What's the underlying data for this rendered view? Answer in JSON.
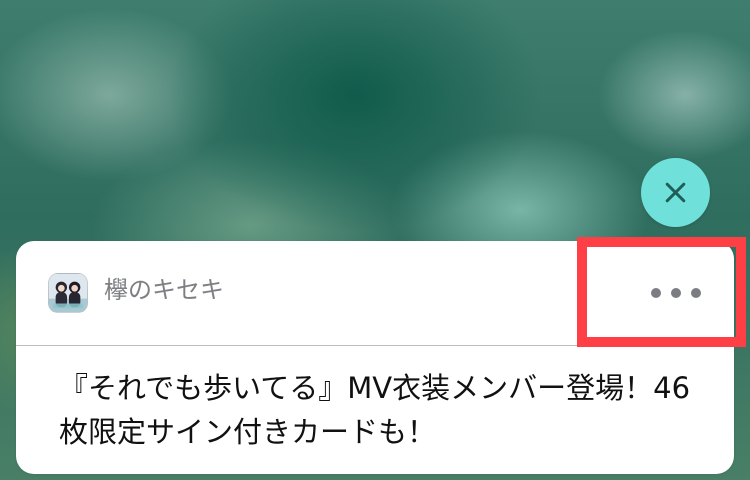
{
  "notification": {
    "app_name": "欅のキセキ",
    "message": "『それでも歩いてる』MV衣装メンバー登場！46枚限定サイン付きカードも！",
    "app_icon_name": "app-icon",
    "more_icon_name": "more-icon",
    "close_icon_name": "close-icon"
  },
  "colors": {
    "close_button": "#6fe1da",
    "card_background": "#ffffff",
    "highlight": "#ff3f46",
    "secondary_text": "#7d7f82",
    "primary_text": "#111111",
    "separator": "#b9bcc2"
  }
}
